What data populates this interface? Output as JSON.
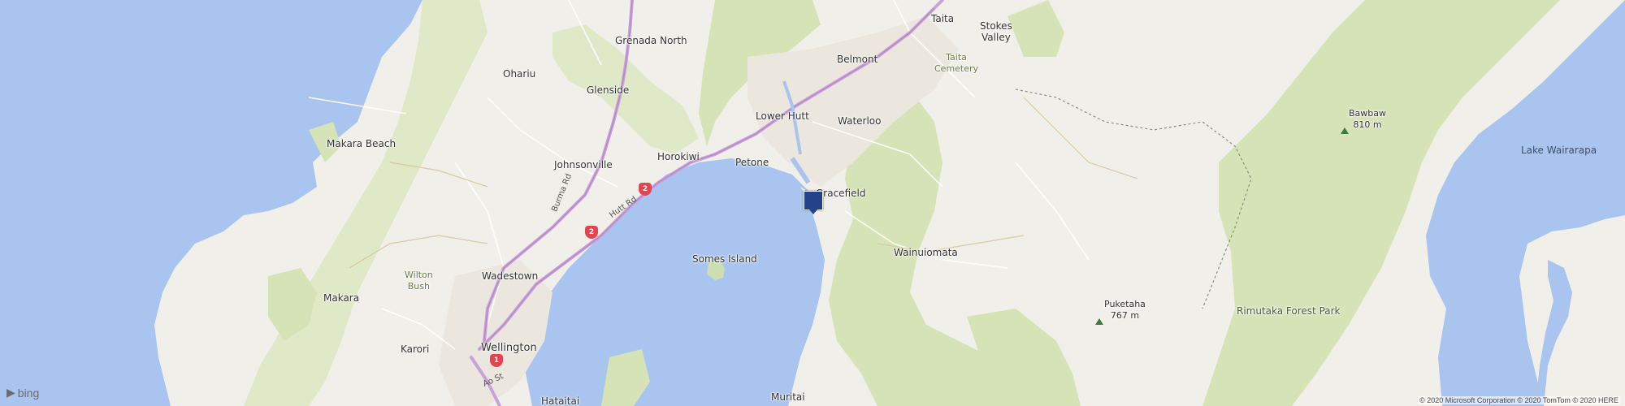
{
  "map": {
    "places": {
      "taita": "Taita",
      "stokes_valley": "Stokes\nValley",
      "grenada_north": "Grenada North",
      "belmont": "Belmont",
      "taita_cemetery": "Taita\nCemetery",
      "ohariu": "Ohariu",
      "glenside": "Glenside",
      "lower_hutt": "Lower Hutt",
      "waterloo": "Waterloo",
      "bawbaw": "Bawbaw\n810 m",
      "makara_beach": "Makara Beach",
      "lake_wairarapa": "Lake Wairarapa",
      "horokiwi": "Horokiwi",
      "johnsonville": "Johnsonville",
      "petone": "Petone",
      "gracefield": "Gracefield",
      "somes_island": "Somes Island",
      "wainuiomata": "Wainuiomata",
      "wilton_bush": "Wilton\nBush",
      "wadestown": "Wadestown",
      "makara": "Makara",
      "puketaha": "Puketaha\n767 m",
      "rimutaka": "Rimutaka Forest Park",
      "karori": "Karori",
      "wellington": "Wellington",
      "hataitai": "Hataitai",
      "muritai": "Muritai"
    },
    "roads": {
      "burma_rd": "Burma Rd",
      "hutt_rd": "Hutt Rd",
      "ao_st": "Ao St"
    },
    "shields": {
      "sh2_a": "2",
      "sh2_b": "2",
      "sh1": "1"
    },
    "logo": "bing",
    "copyright": "© 2020 Microsoft Corporation © 2020 TomTom © 2020 HERE",
    "colors": {
      "water": "#a9c4ef",
      "land": "#f1efe9",
      "park": "#d6e3b7",
      "road_major": "#c9a2d9",
      "shield": "#e34450",
      "pin": "#23428a"
    }
  }
}
